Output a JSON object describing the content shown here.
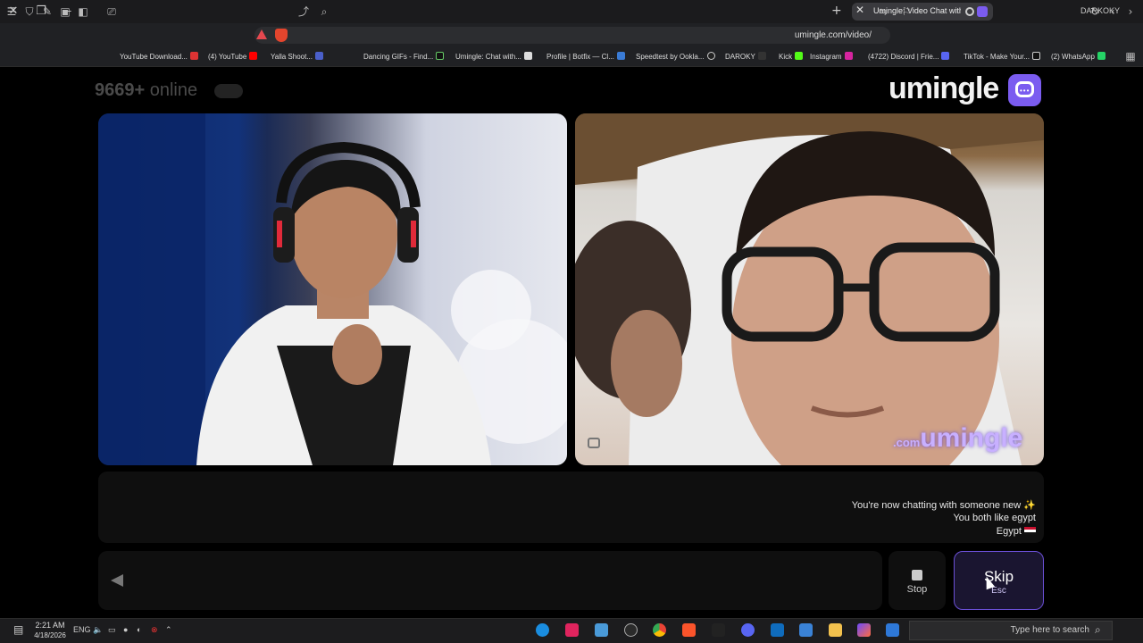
{
  "browser": {
    "profile_name": "DARKOKY",
    "tab_title": "Umingle: Video Chat with Str...",
    "url": "umingle.com/video/",
    "bookmarks": [
      "YouTube Download...",
      "(4) YouTube",
      "Yalla Shoot...",
      "Dancing GIFs - Find...",
      "Umingle: Chat with...",
      "Profile | Botfix — Cl...",
      "Speedtest by Ookla...",
      "DAROKY",
      "Kick",
      "Instagram",
      "(4722) Discord | Frie...",
      "TikTok - Make Your...",
      "(2) WhatsApp"
    ]
  },
  "page": {
    "online_count": "9669+",
    "online_label": "online",
    "logo_text": "umingle",
    "watermark": "umingle",
    "watermark_suffix": ".com",
    "chat": {
      "system_message": "You're now chatting with someone new",
      "common_interest": "You both like egypt",
      "country": "Egypt"
    },
    "stop_label": "Stop",
    "skip_label": "Skip",
    "skip_key": "Esc"
  },
  "taskbar": {
    "search_placeholder": "Type here to search",
    "time": "2:21 AM",
    "date": "4/18/2026",
    "language": "ENG"
  },
  "colors": {
    "brand": "#7b5cf0",
    "background": "#000000",
    "panel": "#0f0f0f"
  }
}
